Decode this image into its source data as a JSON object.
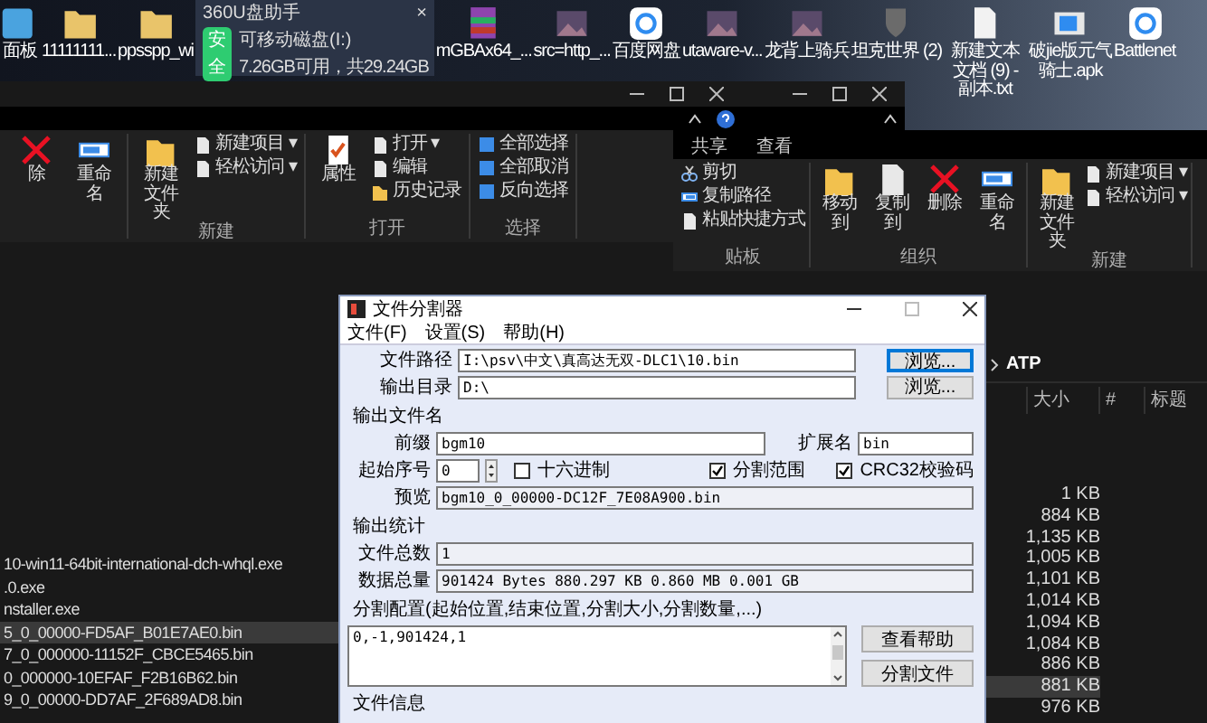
{
  "desktop_icons": [
    {
      "label": "面板",
      "kind": "blue"
    },
    {
      "label": "11111111...",
      "kind": "folder"
    },
    {
      "label": "ppsspp_wi",
      "kind": "folder"
    },
    {
      "label": "mGBAx64_...",
      "kind": "archive"
    },
    {
      "label": "src=http_...",
      "kind": "image"
    },
    {
      "label": "百度网盘",
      "kind": "cloud"
    },
    {
      "label": "utaware-v...",
      "kind": "image"
    },
    {
      "label": "龙背上骑兵",
      "kind": "image"
    },
    {
      "label": "坦克世界 (2)",
      "kind": "shield"
    },
    {
      "label": "新建文本文档 (9) - 副本.txt",
      "kind": "doc"
    },
    {
      "label": "破jie版元气骑士.apk",
      "kind": "window"
    },
    {
      "label": "Battlenet",
      "kind": "cloud"
    }
  ],
  "usb_popup": {
    "title": "360U盘助手",
    "badge": "安全",
    "drive": "可移动磁盘(I:)",
    "space": "7.26GB可用，共29.24GB",
    "close": "×"
  },
  "left_explorer": {
    "ribbon": [
      {
        "large": [
          {
            "label": "除",
            "kind": "delete"
          },
          {
            "label": "重命名",
            "kind": "rename"
          }
        ]
      },
      {
        "label": "新建",
        "large": [
          {
            "label": "新建文件夹",
            "kind": "folder"
          }
        ],
        "small": [
          {
            "label": "新建项目 ▾",
            "kind": "doc"
          },
          {
            "label": "轻松访问 ▾",
            "kind": "doc"
          }
        ]
      },
      {
        "label": "打开",
        "large": [
          {
            "label": "属性",
            "kind": "check"
          }
        ],
        "small": [
          {
            "label": "打开 ▾",
            "kind": "doc"
          },
          {
            "label": "编辑",
            "kind": "doc"
          },
          {
            "label": "历史记录",
            "kind": "folder"
          }
        ]
      },
      {
        "label": "选择",
        "small": [
          {
            "label": "全部选择",
            "kind": "grid"
          },
          {
            "label": "全部取消",
            "kind": "grid"
          },
          {
            "label": "反向选择",
            "kind": "grid"
          }
        ]
      }
    ],
    "files": [
      {
        "name": "10-win11-64bit-international-dch-whql.exe",
        "selected": false
      },
      {
        "name": ".0.exe",
        "selected": false
      },
      {
        "name": "nstaller.exe",
        "selected": false
      },
      {
        "name": "5_0_00000-FD5AF_B01E7AE0.bin",
        "selected": true
      },
      {
        "name": "7_0_000000-11152F_CBCE5465.bin",
        "selected": false
      },
      {
        "name": "0_000000-10EFAF_F2B16B62.bin",
        "selected": false
      },
      {
        "name": "9_0_00000-DD7AF_2F689AD8.bin",
        "selected": false
      }
    ]
  },
  "right_explorer": {
    "tabs": [
      {
        "label": "共享",
        "selected": false
      },
      {
        "label": "查看",
        "selected": false
      }
    ],
    "ribbon": [
      {
        "label": "贴板",
        "small": [
          {
            "label": "剪切",
            "kind": "cut"
          },
          {
            "label": "复制路径",
            "kind": "rename"
          },
          {
            "label": "粘贴快捷方式",
            "kind": "doc"
          }
        ]
      },
      {
        "label": "组织",
        "large": [
          {
            "label": "移动到",
            "kind": "folder"
          },
          {
            "label": "复制到",
            "kind": "doc"
          },
          {
            "label": "删除",
            "kind": "delete"
          },
          {
            "label": "重命名",
            "kind": "rename"
          }
        ]
      },
      {
        "label": "新建",
        "large": [
          {
            "label": "新建文件夹",
            "kind": "folder"
          }
        ],
        "small": [
          {
            "label": "新建项目 ▾",
            "kind": "doc"
          },
          {
            "label": "轻松访问 ▾",
            "kind": "doc"
          }
        ]
      }
    ],
    "breadcrumb": "ATP",
    "columns": [
      "大小",
      "#",
      "标题"
    ],
    "rows": [
      {
        "size": "1 KB",
        "selected": false
      },
      {
        "size": "884 KB",
        "selected": false
      },
      {
        "size": "1,135 KB",
        "selected": false
      },
      {
        "size": "1,005 KB",
        "selected": false
      },
      {
        "size": "1,101 KB",
        "selected": false
      },
      {
        "size": "1,014 KB",
        "selected": false
      },
      {
        "size": "1,094 KB",
        "selected": false
      },
      {
        "size": "1,084 KB",
        "selected": false
      },
      {
        "size": "886 KB",
        "selected": false
      },
      {
        "size": "881 KB",
        "selected": true
      },
      {
        "size": "976 KB",
        "selected": false
      }
    ]
  },
  "splitter_dialog": {
    "title": "文件分割器",
    "menu": [
      "文件(F)",
      "设置(S)",
      "帮助(H)"
    ],
    "file_path": {
      "label": "文件路径",
      "value": "I:\\psv\\中文\\真高达无双-DLC1\\10.bin",
      "button": "浏览...",
      "focused": true
    },
    "output_dir": {
      "label": "输出目录",
      "value": "D:\\",
      "button": "浏览...",
      "focused": false
    },
    "output_name": {
      "heading": "输出文件名",
      "prefix": {
        "label": "前缀",
        "value": "bgm10"
      },
      "extension": {
        "label": "扩展名",
        "value": "bin"
      },
      "start_index": {
        "label": "起始序号",
        "value": "0"
      },
      "options": [
        {
          "label": "十六进制",
          "checked": false
        },
        {
          "label": "分割范围",
          "checked": true
        },
        {
          "label": "CRC32校验码",
          "checked": true
        }
      ],
      "preview": {
        "label": "预览",
        "value": "bgm10_0_00000-DC12F_7E08A900.bin"
      }
    },
    "output_stats": {
      "heading": "输出统计",
      "file_count": {
        "label": "文件总数",
        "value": "1"
      },
      "data_total": {
        "label": "数据总量",
        "value": "901424 Bytes  880.297 KB  0.860 MB  0.001 GB"
      }
    },
    "split_config": {
      "heading": "分割配置(起始位置,结束位置,分割大小,分割数量,...)",
      "value": "0,-1,901424,1",
      "buttons": [
        "查看帮助",
        "分割文件"
      ]
    },
    "file_info": {
      "heading": "文件信息"
    }
  }
}
